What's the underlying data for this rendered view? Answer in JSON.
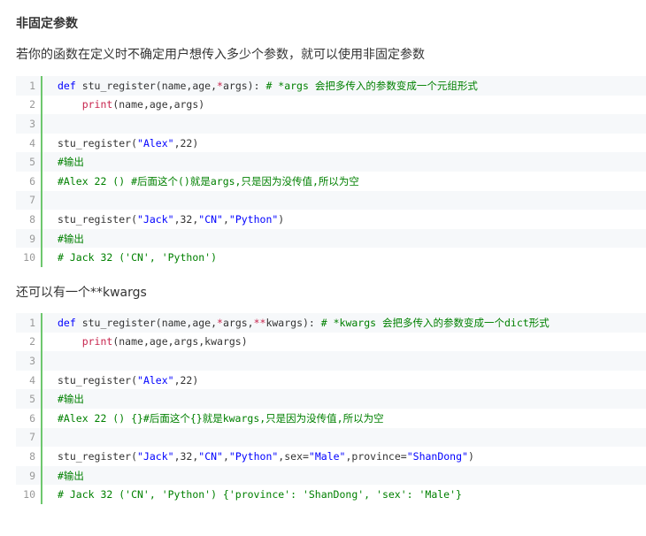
{
  "heading": "非固定参数",
  "intro": "若你的函数在定义时不确定用户想传入多少个参数，就可以使用非固定参数",
  "middle_text": "还可以有一个**kwargs",
  "block1": [
    {
      "n": "1",
      "t": [
        [
          "kw",
          "def"
        ],
        [
          "p",
          " stu_register(name,age,"
        ],
        [
          "op",
          "*"
        ],
        [
          "p",
          "args): "
        ],
        [
          "cm",
          "# *args 会把多传入的参数变成一个元组形式"
        ]
      ]
    },
    {
      "n": "2",
      "t": [
        [
          "p",
          "    "
        ],
        [
          "bi",
          "print"
        ],
        [
          "p",
          "(name,age,args)"
        ]
      ]
    },
    {
      "n": "3",
      "t": []
    },
    {
      "n": "4",
      "t": [
        [
          "p",
          "stu_register("
        ],
        [
          "str",
          "\"Alex\""
        ],
        [
          "p",
          ",22)"
        ]
      ]
    },
    {
      "n": "5",
      "t": [
        [
          "cm",
          "#输出"
        ]
      ]
    },
    {
      "n": "6",
      "t": [
        [
          "cm",
          "#Alex 22 () #后面这个()就是args,只是因为没传值,所以为空"
        ]
      ]
    },
    {
      "n": "7",
      "t": []
    },
    {
      "n": "8",
      "t": [
        [
          "p",
          "stu_register("
        ],
        [
          "str",
          "\"Jack\""
        ],
        [
          "p",
          ",32,"
        ],
        [
          "str",
          "\"CN\""
        ],
        [
          "p",
          ","
        ],
        [
          "str",
          "\"Python\""
        ],
        [
          "p",
          ")"
        ]
      ]
    },
    {
      "n": "9",
      "t": [
        [
          "cm",
          "#输出"
        ]
      ]
    },
    {
      "n": "10",
      "t": [
        [
          "cm",
          "# Jack 32 ('CN', 'Python')"
        ]
      ]
    }
  ],
  "block2": [
    {
      "n": "1",
      "t": [
        [
          "kw",
          "def"
        ],
        [
          "p",
          " stu_register(name,age,"
        ],
        [
          "op",
          "*"
        ],
        [
          "p",
          "args,"
        ],
        [
          "op",
          "**"
        ],
        [
          "p",
          "kwargs): "
        ],
        [
          "cm",
          "# *kwargs 会把多传入的参数变成一个dict形式"
        ]
      ]
    },
    {
      "n": "2",
      "t": [
        [
          "p",
          "    "
        ],
        [
          "bi",
          "print"
        ],
        [
          "p",
          "(name,age,args,kwargs)"
        ]
      ]
    },
    {
      "n": "3",
      "t": []
    },
    {
      "n": "4",
      "t": [
        [
          "p",
          "stu_register("
        ],
        [
          "str",
          "\"Alex\""
        ],
        [
          "p",
          ",22)"
        ]
      ]
    },
    {
      "n": "5",
      "t": [
        [
          "cm",
          "#输出"
        ]
      ]
    },
    {
      "n": "6",
      "t": [
        [
          "cm",
          "#Alex 22 () {}#后面这个{}就是kwargs,只是因为没传值,所以为空"
        ]
      ]
    },
    {
      "n": "7",
      "t": []
    },
    {
      "n": "8",
      "t": [
        [
          "p",
          "stu_register("
        ],
        [
          "str",
          "\"Jack\""
        ],
        [
          "p",
          ",32,"
        ],
        [
          "str",
          "\"CN\""
        ],
        [
          "p",
          ","
        ],
        [
          "str",
          "\"Python\""
        ],
        [
          "p",
          ",sex="
        ],
        [
          "str",
          "\"Male\""
        ],
        [
          "p",
          ",province="
        ],
        [
          "str",
          "\"ShanDong\""
        ],
        [
          "p",
          ")"
        ]
      ]
    },
    {
      "n": "9",
      "t": [
        [
          "cm",
          "#输出"
        ]
      ]
    },
    {
      "n": "10",
      "t": [
        [
          "cm",
          "# Jack 32 ('CN', 'Python') {'province': 'ShanDong', 'sex': 'Male'}"
        ]
      ]
    }
  ]
}
